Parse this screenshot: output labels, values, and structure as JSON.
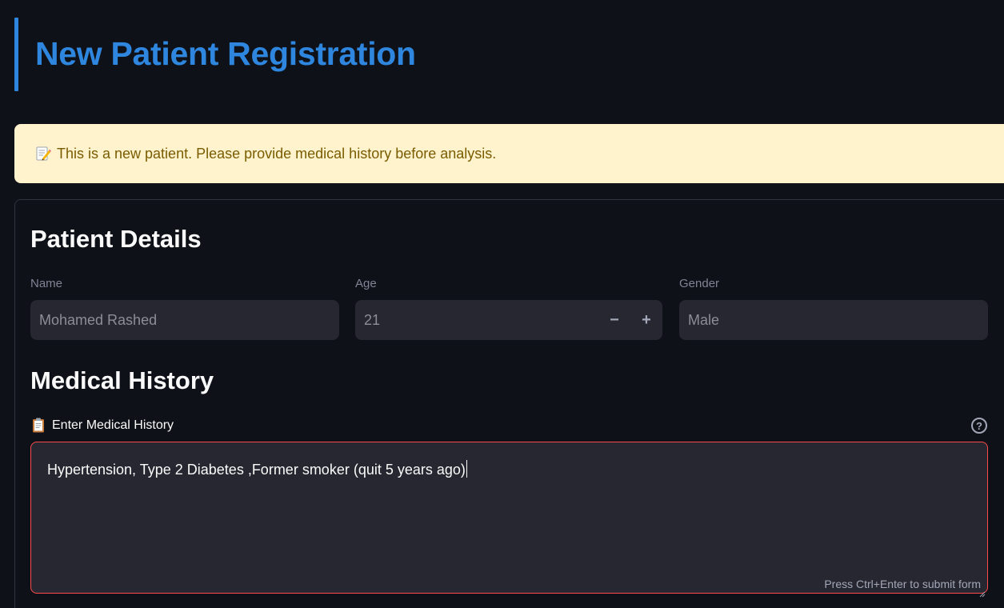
{
  "header": {
    "title": "New Patient Registration"
  },
  "alert": {
    "icon": "memo-icon",
    "message": "This is a new patient. Please provide medical history before analysis."
  },
  "patient_details": {
    "title": "Patient Details",
    "name": {
      "label": "Name",
      "value": "Mohamed Rashed"
    },
    "age": {
      "label": "Age",
      "value": "21",
      "decrement": "−",
      "increment": "+"
    },
    "gender": {
      "label": "Gender",
      "value": "Male"
    }
  },
  "medical_history": {
    "title": "Medical History",
    "label_icon": "clipboard-icon",
    "label": "Enter Medical History",
    "help_icon": "?",
    "value": "Hypertension, Type 2 Diabetes ,Former smoker (quit 5 years ago)",
    "hint": "Press Ctrl+Enter to submit form"
  },
  "colors": {
    "background": "#0e1117",
    "accent": "#2e86de",
    "alert_bg": "#fff3cd",
    "alert_text": "#7a5c00",
    "input_bg": "#262730",
    "focus_border": "#ff4b4b"
  }
}
